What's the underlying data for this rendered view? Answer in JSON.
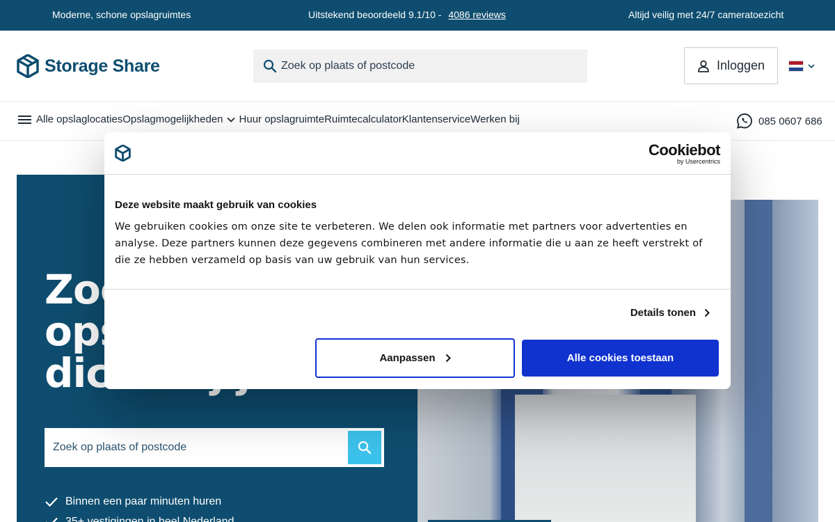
{
  "topbar": {
    "left_text": "Moderne, schone opslagruimtes",
    "rating_text": "Uitstekend beoordeeld  9.1/10  -",
    "reviews_link": "4086 reviews",
    "right_text": "Altijd veilig met 24/7 cameratoezicht"
  },
  "header": {
    "brand": "Storage Share",
    "search_placeholder": "Zoek op plaats of postcode",
    "login_label": "Inloggen"
  },
  "nav": {
    "items": [
      "Alle opslaglocaties",
      "Opslagmogelijkheden",
      "Huur opslagruimte",
      "Ruimtecalculator",
      "Klantenservice",
      "Werken bij"
    ],
    "phone": "085 0607 686"
  },
  "hero": {
    "title_line1": "Zoek",
    "title_line2": "ops",
    "title_line3": "dicht bij je",
    "search_placeholder": "Zoek op plaats of postcode",
    "usps": [
      "Binnen een paar minuten huren",
      "35+ vestigingen in heel Nederland"
    ]
  },
  "cookie": {
    "provider": "Cookiebot",
    "provider_sub": "by Usercentrics",
    "title": "Deze website maakt gebruik van cookies",
    "body": "We gebruiken cookies om onze site te verbeteren. We delen ook informatie met partners voor advertenties en analyse. Deze partners kunnen deze gegevens combineren met andere informatie die u aan ze heeft verstrekt of die ze hebben verzameld op basis van uw gebruik van hun services.",
    "details_label": "Details tonen",
    "customize_label": "Aanpassen",
    "accept_label": "Alle cookies toestaan"
  },
  "colors": {
    "brand": "#0e4d6f",
    "accent": "#3cc3ec",
    "cookie_button": "#1032cf"
  }
}
